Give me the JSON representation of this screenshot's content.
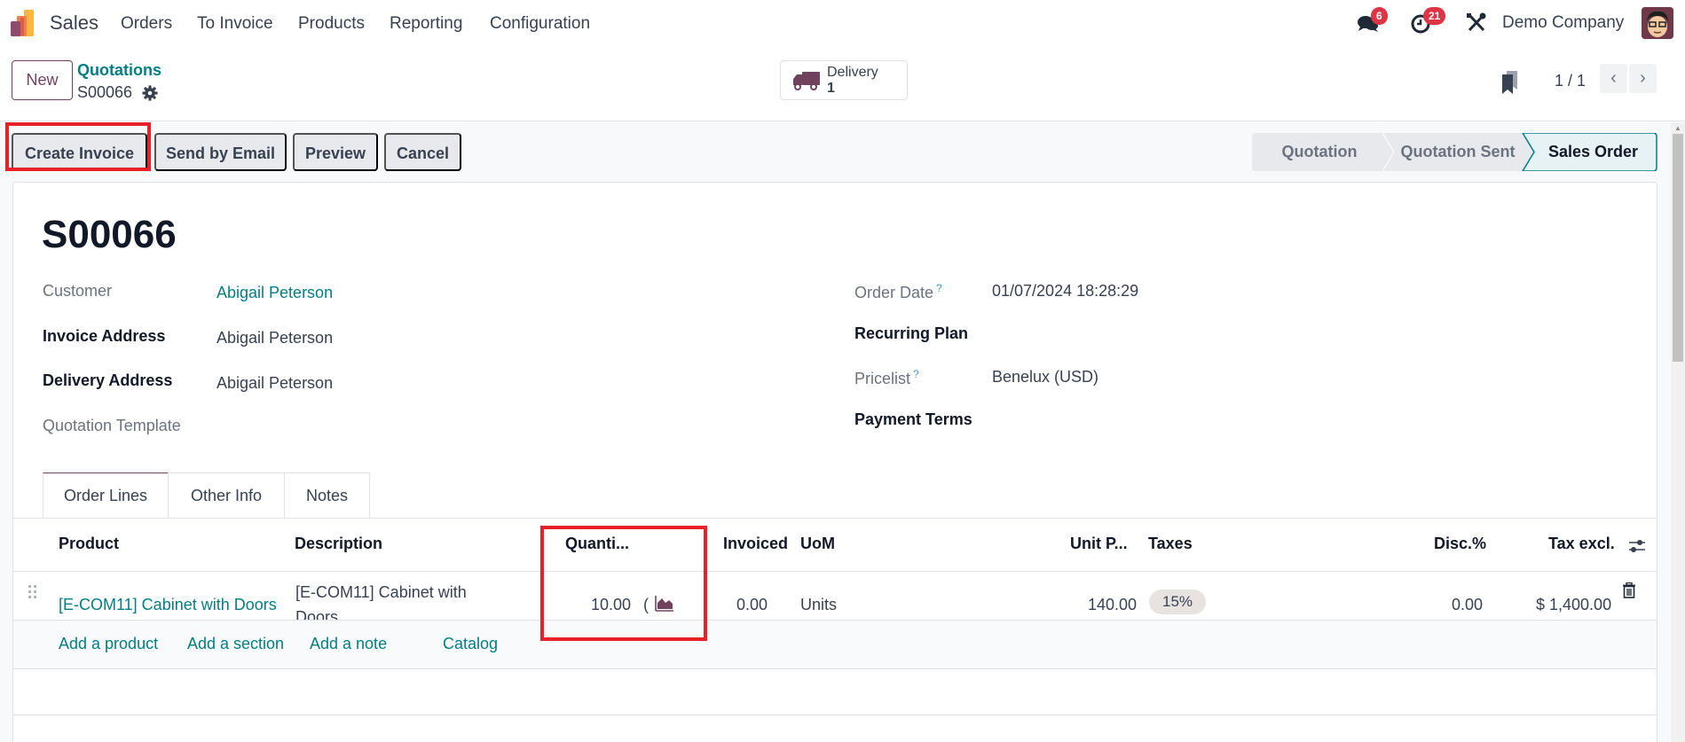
{
  "navbar": {
    "app_name": "Sales",
    "menu": [
      "Orders",
      "To Invoice",
      "Products",
      "Reporting",
      "Configuration"
    ],
    "messages_badge": "6",
    "activities_badge": "21",
    "company": "Demo Company",
    "icons": [
      "sales-logo-icon",
      "chat-icon",
      "clock-icon",
      "tools-icon",
      "avatar"
    ]
  },
  "control_panel": {
    "new_label": "New",
    "breadcrumb_parent": "Quotations",
    "breadcrumb_current": "S00066",
    "smart_button": {
      "label": "Delivery",
      "value": "1"
    },
    "pager": "1 / 1"
  },
  "actions": {
    "create_invoice": "Create Invoice",
    "send_by_email": "Send by Email",
    "preview": "Preview",
    "cancel": "Cancel"
  },
  "statusbar": {
    "stages": [
      "Quotation",
      "Quotation Sent",
      "Sales Order"
    ],
    "current": "Sales Order"
  },
  "form": {
    "title": "S00066",
    "left_fields": [
      {
        "label": "Customer",
        "value": "Abigail Peterson"
      },
      {
        "label": "Invoice Address",
        "value": "Abigail Peterson"
      },
      {
        "label": "Delivery Address",
        "value": "Abigail Peterson"
      },
      {
        "label": "Quotation Template",
        "value": ""
      }
    ],
    "right_fields": [
      {
        "label": "Order Date",
        "tooltip": "?",
        "value": "01/07/2024 18:28:29"
      },
      {
        "label": "Recurring Plan",
        "value": ""
      },
      {
        "label": "Pricelist",
        "tooltip": "?",
        "value": "Benelux (USD)"
      },
      {
        "label": "Payment Terms",
        "value": ""
      }
    ]
  },
  "tabs": [
    "Order Lines",
    "Other Info",
    "Notes"
  ],
  "order_lines": {
    "columns": [
      "Product",
      "Description",
      "Quanti...",
      "Invoiced",
      "UoM",
      "Unit P...",
      "Taxes",
      "Disc.%",
      "Tax excl."
    ],
    "rows": [
      {
        "product": "[E-COM11] Cabinet with Doors",
        "description_line1": "[E-COM11] Cabinet with",
        "description_line2": "Doors",
        "quantity": "10.00",
        "quantity_suffix": "(",
        "invoiced": "0.00",
        "uom": "Units",
        "unit_price": "140.00",
        "taxes": "15%",
        "discount": "0.00",
        "subtotal": "$ 1,400.00"
      }
    ],
    "add_links": [
      "Add a product",
      "Add a section",
      "Add a note",
      "Catalog"
    ]
  },
  "colors": {
    "primary": "#71425e",
    "link": "#017e84",
    "highlight": "#e8202a",
    "badge": "#dc3545"
  }
}
